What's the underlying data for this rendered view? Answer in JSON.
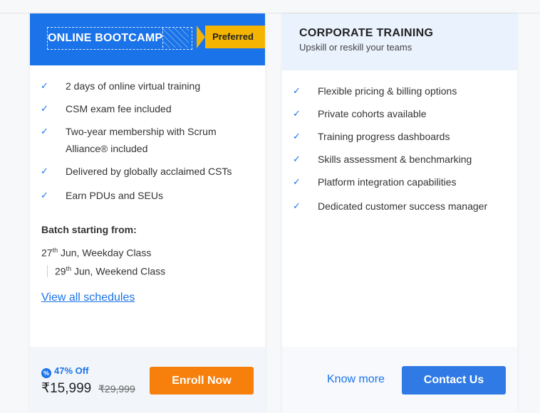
{
  "left_card": {
    "title": "ONLINE BOOTCAMP",
    "badge": "Preferred",
    "features": [
      "2 days of online virtual training",
      "CSM exam fee included",
      "Two-year membership with Scrum Alliance® included",
      "Delivered by globally acclaimed CSTs",
      "Earn PDUs and SEUs"
    ],
    "batch_label": "Batch starting from:",
    "batches": [
      {
        "day": "27",
        "suffix": "th",
        "rest": " Jun, Weekday Class"
      },
      {
        "day": "29",
        "suffix": "th",
        "rest": " Jun, Weekend Class"
      }
    ],
    "view_all": "View all schedules",
    "discount": "47% Off",
    "price": "₹15,999",
    "old_price": "₹29,999",
    "enroll_label": "Enroll Now"
  },
  "right_card": {
    "title": "CORPORATE TRAINING",
    "subtitle": "Upskill or reskill your teams",
    "features": [
      "Flexible pricing & billing options",
      "Private cohorts available",
      "Training progress dashboards",
      "Skills assessment & benchmarking",
      "Platform integration capabilities",
      "Dedicated customer success manager"
    ],
    "know_more": "Know more",
    "contact_label": "Contact Us"
  },
  "icons": {
    "check": "check-icon",
    "discount": "discount-badge-icon"
  },
  "colors": {
    "primary": "#1a73e8",
    "badge": "#f4b400",
    "enroll": "#f77f0c",
    "contact": "#2f7ae5"
  }
}
